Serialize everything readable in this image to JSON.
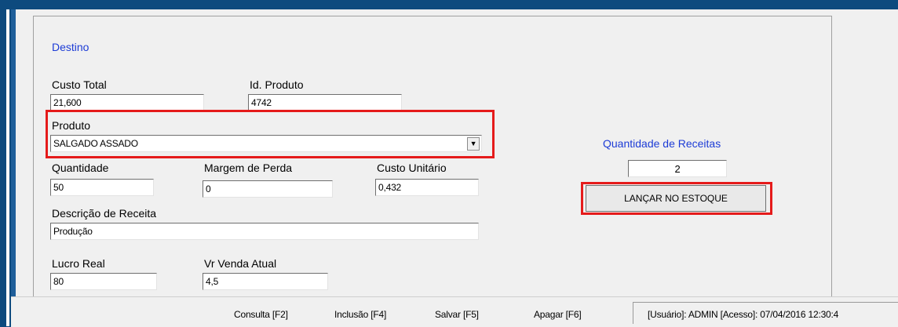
{
  "section_title": "Destino",
  "fields": {
    "custo_total": {
      "label": "Custo Total",
      "value": "21,600"
    },
    "id_produto": {
      "label": "Id. Produto",
      "value": "4742"
    },
    "produto": {
      "label": "Produto",
      "value": "SALGADO ASSADO"
    },
    "quantidade": {
      "label": "Quantidade",
      "value": "50"
    },
    "margem_perda": {
      "label": "Margem de Perda",
      "value": "0"
    },
    "custo_unitario": {
      "label": "Custo Unitário",
      "value": "0,432"
    },
    "descricao": {
      "label": "Descrição de Receita",
      "value": "Produção"
    },
    "lucro_real": {
      "label": "Lucro Real",
      "value": "80"
    },
    "vr_venda_atual": {
      "label": "Vr Venda Atual",
      "value": "4,5"
    }
  },
  "receitas": {
    "label": "Quantidade de Receitas",
    "value": "2",
    "button": "LANÇAR NO ESTOQUE"
  },
  "statusbar": {
    "consulta": "Consulta [F2]",
    "inclusao": "Inclusão [F4]",
    "salvar": "Salvar [F5]",
    "apagar": "Apagar [F6]",
    "session": "[Usuário]: ADMIN [Acesso]: 07/04/2016 12:30:4"
  },
  "colors": {
    "highlight": "#e51b1b",
    "label_blue": "#1d3cd6",
    "frame_blue": "#0d4a7e"
  }
}
